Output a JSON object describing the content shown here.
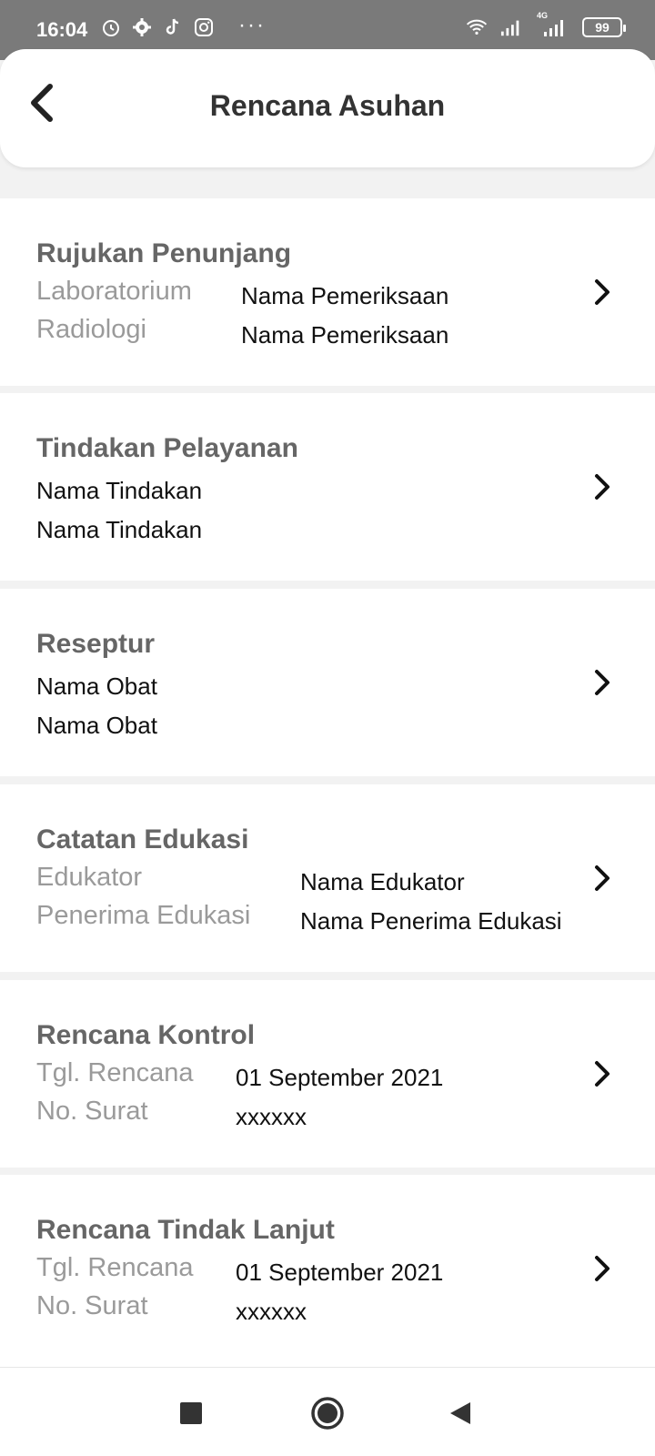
{
  "status_bar": {
    "time": "16:04",
    "icons_left": [
      "alarm-icon",
      "gear-icon",
      "tiktok-icon",
      "instagram-icon"
    ],
    "more": "···",
    "battery": "99",
    "network": "4G"
  },
  "header": {
    "title": "Rencana Asuhan",
    "back_icon": "chevron-left-icon"
  },
  "sections": [
    {
      "title": "Rujukan Penunjang",
      "rows": [
        {
          "label": "Laboratorium",
          "value": "Nama Pemeriksaan"
        },
        {
          "label": "Radiologi",
          "value": "Nama Pemeriksaan"
        }
      ]
    },
    {
      "title": "Tindakan Pelayanan",
      "items": [
        "Nama Tindakan",
        "Nama Tindakan"
      ]
    },
    {
      "title": "Reseptur",
      "items": [
        "Nama Obat",
        "Nama Obat"
      ]
    },
    {
      "title": "Catatan Edukasi",
      "rows": [
        {
          "label": "Edukator",
          "value": "Nama Edukator"
        },
        {
          "label": "Penerima Edukasi",
          "value": "Nama Penerima Edukasi"
        }
      ]
    },
    {
      "title": "Rencana Kontrol",
      "rows": [
        {
          "label": "Tgl. Rencana",
          "value": "01 September 2021"
        },
        {
          "label": "No. Surat",
          "value": "xxxxxx"
        }
      ]
    },
    {
      "title": "Rencana Tindak Lanjut",
      "rows": [
        {
          "label": "Tgl. Rencana",
          "value": "01 September 2021"
        },
        {
          "label": "No. Surat",
          "value": "xxxxxx"
        }
      ]
    }
  ],
  "navbar": {
    "buttons": [
      "recents-icon",
      "home-icon",
      "back-icon"
    ]
  }
}
